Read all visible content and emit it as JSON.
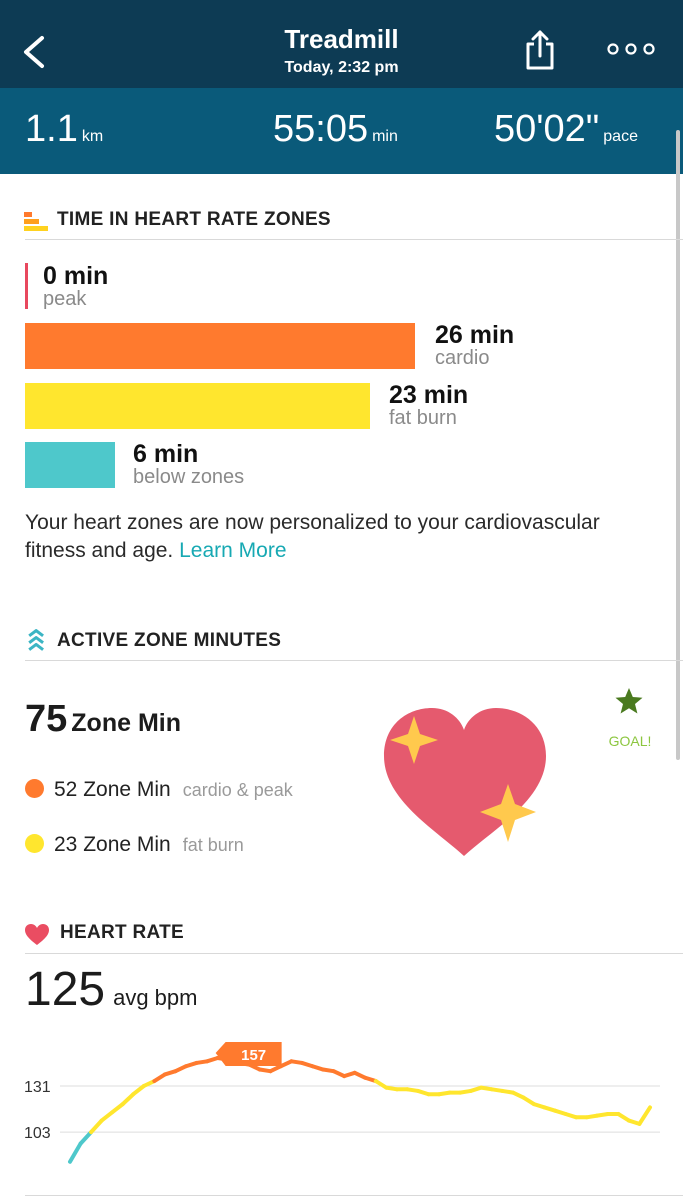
{
  "header": {
    "title": "Treadmill",
    "subtitle": "Today, 2:32 pm",
    "back_icon": "chevron-left-icon",
    "share_icon": "share-icon",
    "more_icon": "more-horizontal-icon"
  },
  "stats": [
    {
      "value": "1.1",
      "unit": "km"
    },
    {
      "value": "55:05",
      "unit": "min"
    },
    {
      "value": "50'02\"",
      "unit": "pace"
    }
  ],
  "hr_zones": {
    "heading": "TIME IN HEART RATE ZONES",
    "zones": [
      {
        "value": "0 min",
        "label": "peak",
        "color": "#e8485e",
        "minutes": 0
      },
      {
        "value": "26 min",
        "label": "cardio",
        "color": "#ff7a2e",
        "minutes": 26
      },
      {
        "value": "23 min",
        "label": "fat burn",
        "color": "#ffe62e",
        "minutes": 23
      },
      {
        "value": "6 min",
        "label": "below zones",
        "color": "#4ec8cb",
        "minutes": 6
      }
    ],
    "text": "Your heart zones are now personalized to your cardiovascular fitness and age.",
    "link": "Learn More"
  },
  "azm": {
    "heading": "ACTIVE ZONE MINUTES",
    "total": "75",
    "total_unit": "Zone Min",
    "rows": [
      {
        "value": "52 Zone Min",
        "desc": "cardio & peak",
        "color": "#ff7a2e"
      },
      {
        "value": "23 Zone Min",
        "desc": "fat burn",
        "color": "#ffe62e"
      }
    ],
    "goal": "GOAL!"
  },
  "heart_rate": {
    "heading": "HEART RATE",
    "avg": "125",
    "avg_unit": "avg bpm"
  },
  "chart_data": {
    "type": "line",
    "y_ticks": [
      131,
      103
    ],
    "peak_label": "157",
    "y_range": [
      80,
      165
    ],
    "colors": {
      "below": "#4ec8cb",
      "fatburn": "#ffe62e",
      "cardio": "#ff7a2e"
    },
    "x": [
      0,
      1,
      2,
      3,
      4,
      5,
      6,
      7,
      8,
      9,
      10,
      11,
      12,
      13,
      14,
      15,
      16,
      17,
      18,
      19,
      20,
      21,
      22,
      23,
      24,
      25,
      26,
      27,
      28,
      29,
      30,
      31,
      32,
      33,
      34,
      35,
      36,
      37,
      38,
      39,
      40,
      41,
      42,
      43,
      44,
      45,
      46,
      47,
      48,
      49,
      50,
      51,
      52,
      53,
      54,
      55
    ],
    "values": [
      85,
      96,
      103,
      110,
      115,
      120,
      126,
      131,
      134,
      138,
      140,
      143,
      145,
      146,
      148,
      147,
      145,
      144,
      141,
      140,
      143,
      146,
      145,
      143,
      141,
      140,
      137,
      139,
      136,
      134,
      130,
      129,
      129,
      128,
      126,
      126,
      127,
      127,
      128,
      130,
      129,
      128,
      127,
      124,
      120,
      118,
      116,
      114,
      112,
      112,
      113,
      114,
      114,
      110,
      108,
      118
    ]
  }
}
